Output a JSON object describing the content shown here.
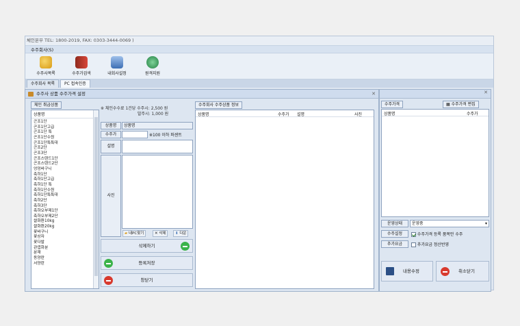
{
  "window": {
    "title": "체인본부 TEL: 1800-2019,  FAX: 0303-3444-0069 )",
    "menu": "수주회사(S)"
  },
  "ribbon": [
    {
      "label": "수주사목록",
      "icon": "coins-icon",
      "color": "#e0a81e"
    },
    {
      "label": "수주가검색",
      "icon": "book-icon",
      "color": "#c23b2b"
    },
    {
      "label": "내회사설정",
      "icon": "network-icon",
      "color": "#4a78b8"
    },
    {
      "label": "원격지원",
      "icon": "support-icon",
      "color": "#2f9a4f"
    }
  ],
  "tabs": [
    "수주회사 목록",
    "PC 접속인증"
  ],
  "left_panel": {
    "title": "수주사 상품 수주가격 설정",
    "list_button": "체인 취급상품",
    "list_header": "상품명",
    "items": [
      "곤조1단",
      "곤조1단고급",
      "곤조1단 특",
      "곤조1단수원",
      "곤조1단특특대",
      "곤조2단",
      "곤조3단",
      "곤조스텐드1단",
      "곤조스텐드2단",
      "엉덩바구니",
      "축하1단",
      "축하1단고급",
      "축하1단 특",
      "축하1단수원",
      "축하1단특특대",
      "축하2단",
      "축하3단",
      "축하오부제1단",
      "축하오부제2단",
      "쌀화환10kg",
      "쌀화환20kg",
      "꽃바구니",
      "꽃상자",
      "꽃다발",
      "관엽화분",
      "분재",
      "동양란",
      "서양란"
    ],
    "note_line1": "※ 체인수수료 1건당 수주시: 2,500 원",
    "note_line2": "발주시: 1,000 원",
    "product_label": "상품명",
    "product_label2": "상품명",
    "price_label": "수주가",
    "price_note": "※100 이하 퍼센트",
    "desc_label": "설명",
    "photo_label": "사진",
    "photo_buttons": [
      "내PC찾기",
      "삭제",
      "다운"
    ],
    "delete_button": "삭제하기",
    "save_button": "등록저장",
    "close_button": "창닫기",
    "grid_button": "수주회사 수주상품 정보",
    "grid_columns": [
      "상품명",
      "수주가",
      "설명",
      "사진"
    ]
  },
  "right_panel": {
    "price_button": "수주가격",
    "edit_button": "수주가격 편집",
    "columns": [
      "상품명",
      "수주가"
    ],
    "status_label": "운영상태",
    "status_value": "운영중",
    "setting_label": "수주설정",
    "setting_text": "수주가격 등록 품목만 수주",
    "extra_label": "추가요금",
    "extra_text": "추가요금 정산반영",
    "modify_button": "내용수정",
    "cancel_button": "취소닫기"
  }
}
